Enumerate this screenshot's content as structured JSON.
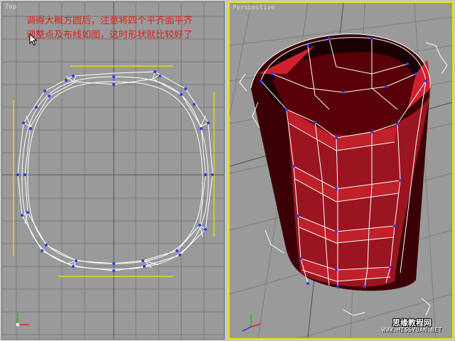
{
  "viewports": {
    "top": {
      "label": "Top",
      "note_lines": [
        "调得大概方圆后，注意将四个平齐面平齐",
        "调整点及布线如图，这时形状就比较好了"
      ],
      "icons": [
        "mouse-cursor-icon",
        "axis-tripod-icon"
      ]
    },
    "perspective": {
      "label": "Perspective",
      "active": true,
      "icons": [
        "axis-tripod-icon"
      ]
    }
  },
  "colors": {
    "viewport_bg": "#9a9a9a",
    "grid": "#7b7b7b",
    "grid_major": "#555555",
    "active_border": "#f2e400",
    "annotation": "#e02018",
    "wire": "#ffffff",
    "vertex": "#2a3cff",
    "mesh_dark": "#3a0005",
    "mesh_red": "#c0202a"
  },
  "watermark": {
    "site_name": "思缘教程网",
    "url": "WWW.MISSYUAN.NET"
  }
}
